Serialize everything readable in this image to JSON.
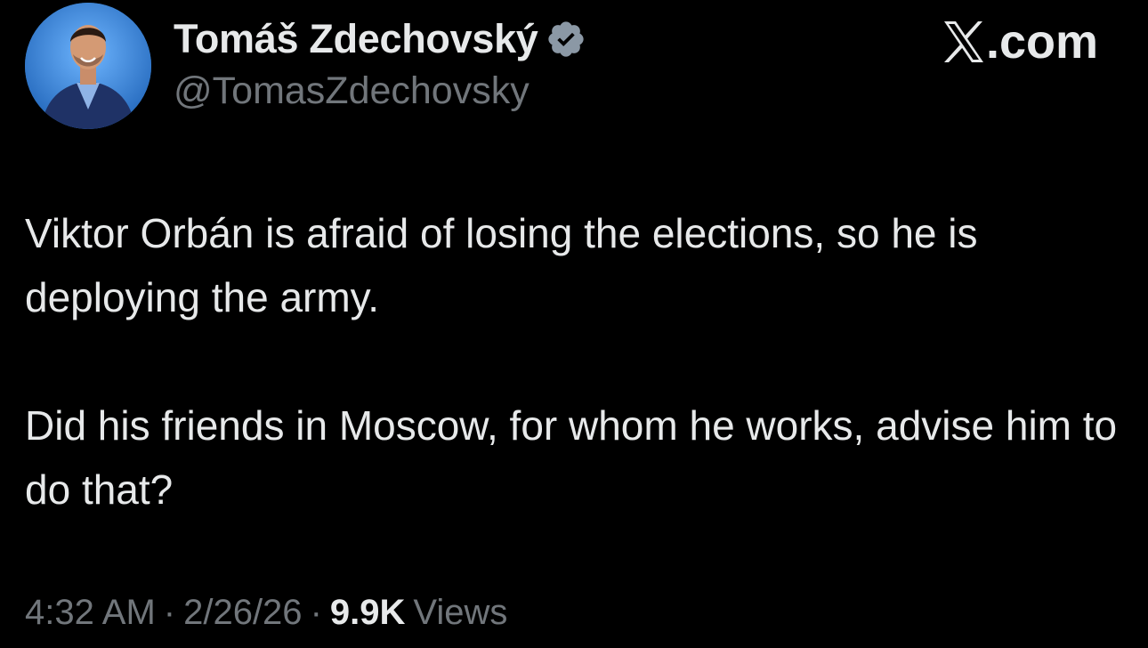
{
  "author": {
    "display_name": "Tomáš Zdechovský",
    "handle": "@TomasZdechovsky",
    "verified": true,
    "avatar_icon": "profile-photo",
    "verified_icon": "verified-badge-icon"
  },
  "brand": {
    "icon": "x-logo-icon",
    "text": ".com"
  },
  "tweet": {
    "paragraphs": [
      "Viktor Orbán is afraid of losing the elections, so he is deploying the army.",
      "Did his friends in Moscow, for whom he works, advise him to do that?"
    ]
  },
  "meta": {
    "time": "4:32 AM",
    "separator": "·",
    "date": "2/26/26",
    "views_count": "9.9K",
    "views_label": "Views"
  },
  "colors": {
    "background": "#000000",
    "primary_text": "#e7e9ea",
    "secondary_text": "#71767b",
    "verified_badge": "#8b98a5"
  }
}
